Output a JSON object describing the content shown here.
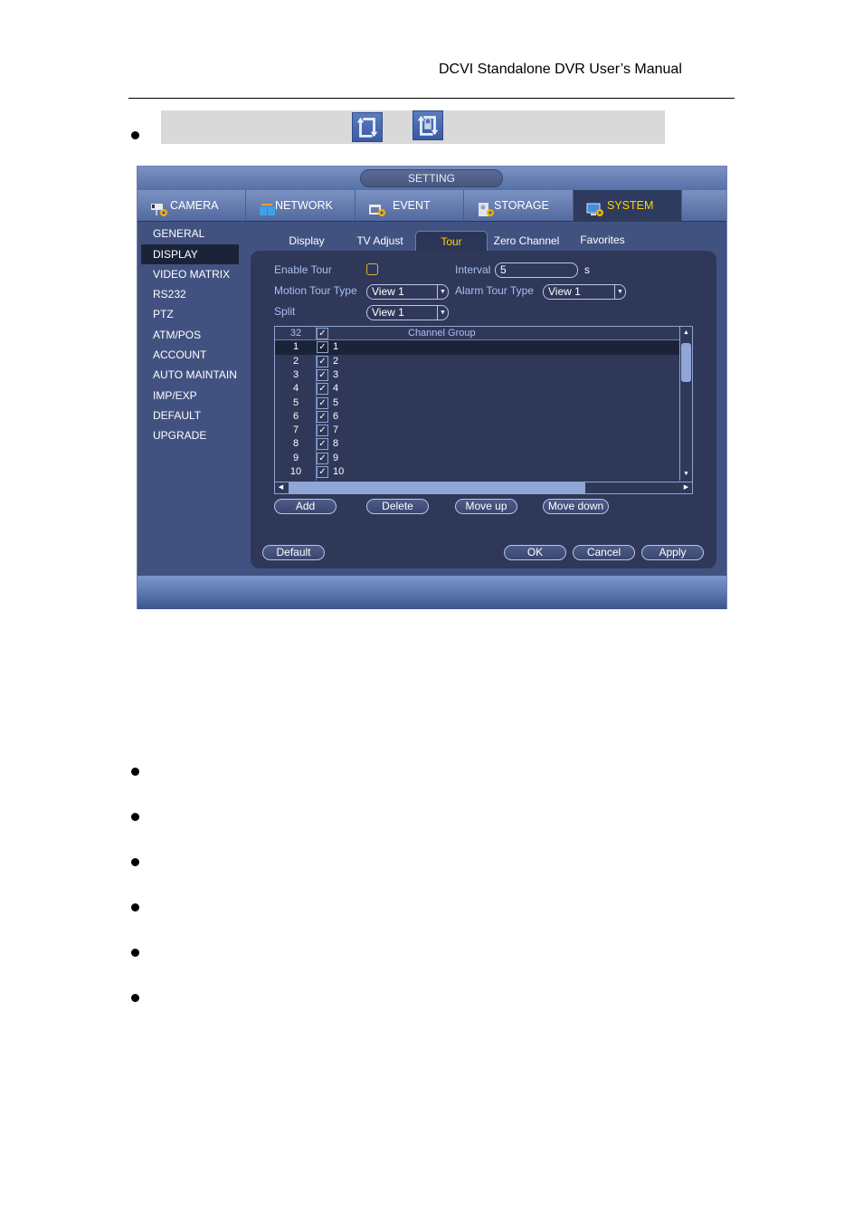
{
  "document": {
    "header_title": "DCVI Standalone DVR User’s Manual",
    "tour_icons": [
      "tour-icon",
      "tour-lock-icon"
    ],
    "empty_bullets_count": 6
  },
  "dvr": {
    "window_title": "SETTING",
    "main_tabs": [
      {
        "label": "CAMERA",
        "icon": "camera-settings-icon",
        "active": false
      },
      {
        "label": "NETWORK",
        "icon": "network-settings-icon",
        "active": false
      },
      {
        "label": "EVENT",
        "icon": "event-settings-icon",
        "active": false
      },
      {
        "label": "STORAGE",
        "icon": "storage-settings-icon",
        "active": false
      },
      {
        "label": "SYSTEM",
        "icon": "system-settings-icon",
        "active": true
      }
    ],
    "sidebar": [
      {
        "label": "GENERAL"
      },
      {
        "label": "DISPLAY",
        "active": true
      },
      {
        "label": "VIDEO MATRIX"
      },
      {
        "label": "RS232"
      },
      {
        "label": "PTZ"
      },
      {
        "label": "ATM/POS"
      },
      {
        "label": "ACCOUNT"
      },
      {
        "label": "AUTO MAINTAIN"
      },
      {
        "label": "IMP/EXP"
      },
      {
        "label": "DEFAULT"
      },
      {
        "label": "UPGRADE"
      }
    ],
    "sub_tabs": [
      {
        "label": "Display"
      },
      {
        "label": "TV Adjust"
      },
      {
        "label": "Tour",
        "active": true
      },
      {
        "label": "Zero Channel"
      },
      {
        "label": "Favorites"
      }
    ],
    "form": {
      "enable_tour_label": "Enable Tour",
      "enable_tour_checked": false,
      "interval_label": "Interval",
      "interval_value": "5",
      "interval_unit": "s",
      "motion_tour_type_label": "Motion Tour Type",
      "motion_tour_type_value": "View 1",
      "alarm_tour_type_label": "Alarm Tour Type",
      "alarm_tour_type_value": "View 1",
      "split_label": "Split",
      "split_value": "View 1"
    },
    "table": {
      "header_count": "32",
      "header_column": "Channel Group",
      "rows": [
        {
          "num": "1",
          "checked": true,
          "group": "1",
          "selected": true
        },
        {
          "num": "2",
          "checked": true,
          "group": "2"
        },
        {
          "num": "3",
          "checked": true,
          "group": "3"
        },
        {
          "num": "4",
          "checked": true,
          "group": "4"
        },
        {
          "num": "5",
          "checked": true,
          "group": "5"
        },
        {
          "num": "6",
          "checked": true,
          "group": "6"
        },
        {
          "num": "7",
          "checked": true,
          "group": "7"
        },
        {
          "num": "8",
          "checked": true,
          "group": "8"
        },
        {
          "num": "9",
          "checked": true,
          "group": "9"
        },
        {
          "num": "10",
          "checked": true,
          "group": "10"
        }
      ]
    },
    "buttons": {
      "add": "Add",
      "delete": "Delete",
      "move_up": "Move up",
      "move_down": "Move down",
      "default": "Default",
      "ok": "OK",
      "cancel": "Cancel",
      "apply": "Apply"
    },
    "colors": {
      "active_accent": "#ffd700",
      "label_blue": "#a9bff0",
      "panel_bg": "#2f3859",
      "window_bg": "#425280"
    }
  }
}
